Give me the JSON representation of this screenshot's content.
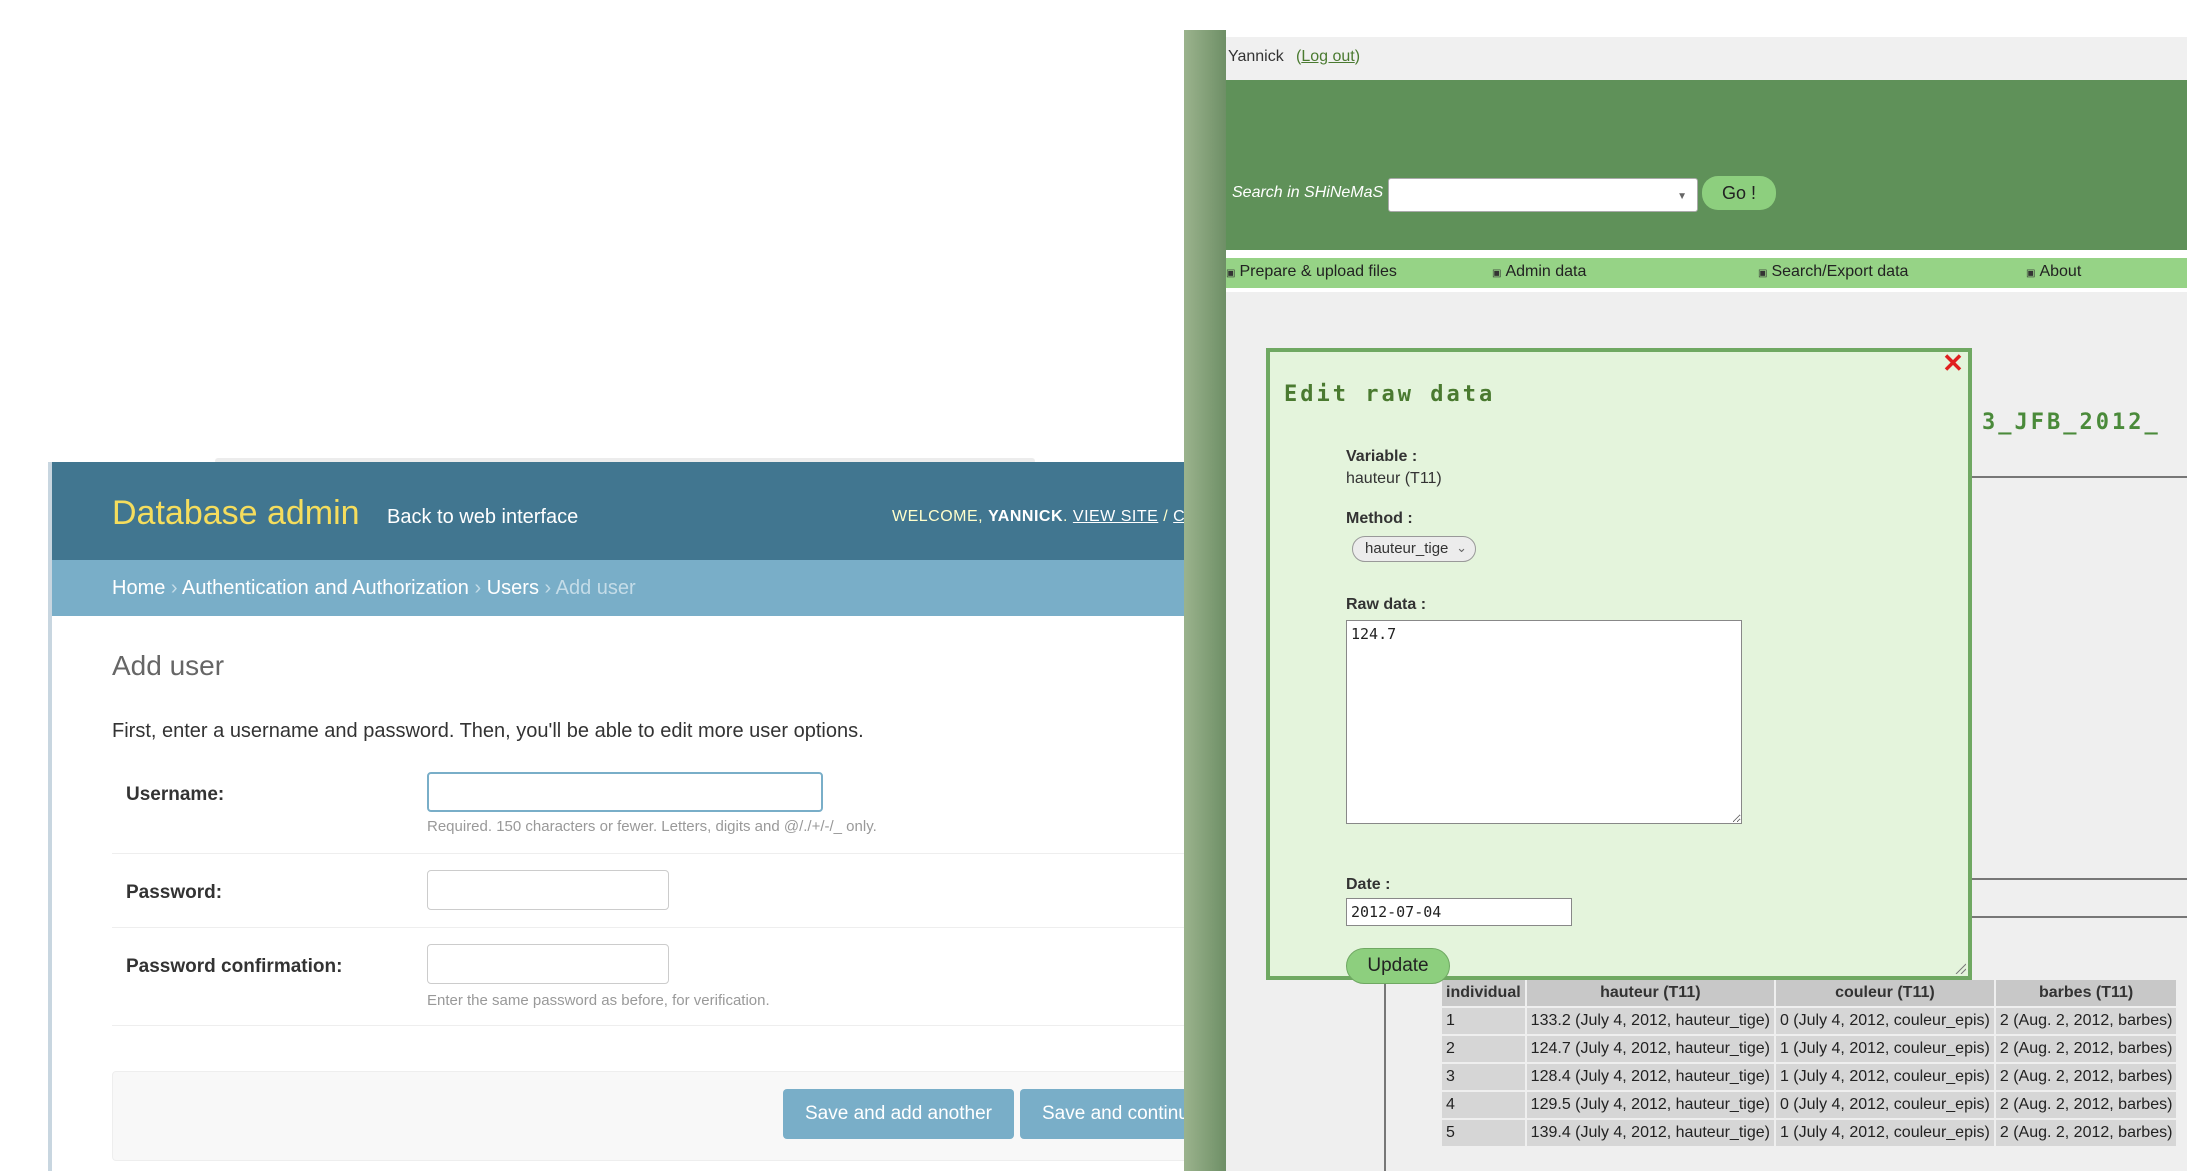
{
  "django": {
    "brand": "Database admin",
    "back_link": "Back to web interface",
    "user_tools": {
      "welcome": "WELCOME,",
      "username": "YANNICK",
      "view_site": "VIEW SITE",
      "sep": "/",
      "change": "CHA"
    },
    "breadcrumbs": {
      "home": "Home",
      "sep": "›",
      "auth": "Authentication and Authorization",
      "users": "Users",
      "current": "Add user"
    },
    "title": "Add user",
    "intro": "First, enter a username and password. Then, you'll be able to edit more user options.",
    "fields": {
      "username": {
        "label": "Username:",
        "help": "Required. 150 characters or fewer. Letters, digits and @/./+/-/_ only."
      },
      "password": {
        "label": "Password:"
      },
      "password_confirmation": {
        "label": "Password confirmation:",
        "help": "Enter the same password as before, for verification."
      }
    },
    "buttons": {
      "save_add_another": "Save and add another",
      "save_continue": "Save and continu"
    }
  },
  "shinemas": {
    "user": "Yannick",
    "logout": "Log out",
    "search_label": "Search in SHiNeMaS :",
    "go": "Go !",
    "nav": [
      "Prepare & upload files",
      "Admin data",
      "Search/Export data",
      "About"
    ],
    "page_title_fragment": "3_JFB_2012_",
    "modal": {
      "title": "Edit raw data",
      "variable_label": "Variable :",
      "variable_value": "hauteur (T11)",
      "method_label": "Method :",
      "method_value": "hauteur_tige",
      "raw_label": "Raw data :",
      "raw_value": "124.7",
      "date_label": "Date :",
      "date_value": "2012-07-04",
      "update": "Update"
    },
    "table": {
      "headers": [
        "individual",
        "hauteur (T11)",
        "couleur (T11)",
        "barbes (T11)"
      ],
      "rows": [
        [
          "1",
          "133.2 (July 4, 2012, hauteur_tige)",
          "0 (July 4, 2012, couleur_epis)",
          "2 (Aug. 2, 2012, barbes)"
        ],
        [
          "2",
          "124.7 (July 4, 2012, hauteur_tige)",
          "1 (July 4, 2012, couleur_epis)",
          "2 (Aug. 2, 2012, barbes)"
        ],
        [
          "3",
          "128.4 (July 4, 2012, hauteur_tige)",
          "1 (July 4, 2012, couleur_epis)",
          "2 (Aug. 2, 2012, barbes)"
        ],
        [
          "4",
          "129.5 (July 4, 2012, hauteur_tige)",
          "0 (July 4, 2012, couleur_epis)",
          "2 (Aug. 2, 2012, barbes)"
        ],
        [
          "5",
          "139.4 (July 4, 2012, hauteur_tige)",
          "1 (July 4, 2012, couleur_epis)",
          "2 (Aug. 2, 2012, barbes)"
        ]
      ]
    }
  },
  "colors": {
    "django_header": "#417690",
    "django_brand": "#f5dd5d",
    "django_breadcrumbs": "#79aec8",
    "shin_banner": "#5f9159",
    "shin_nav": "#96d386",
    "shin_modal_bg": "#e4f4dc",
    "close_red": "#e02020"
  }
}
